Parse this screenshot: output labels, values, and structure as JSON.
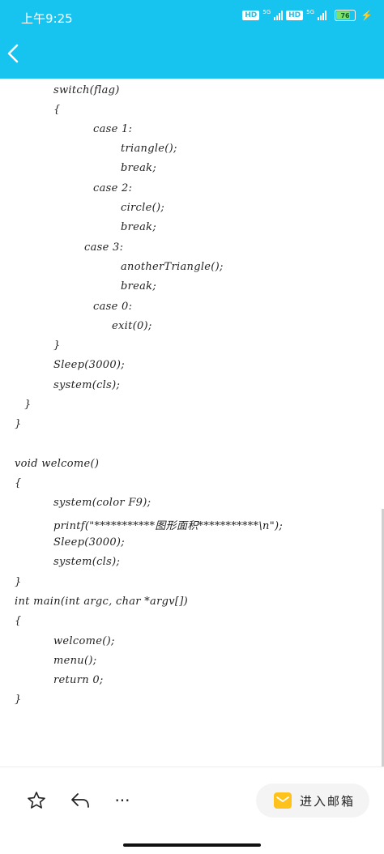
{
  "status_bar": {
    "time": "上午9:25",
    "hd1": "HD",
    "net1": "5G",
    "hd2": "HD",
    "net2": "5G",
    "battery": "76"
  },
  "header": {
    "back_icon": "chevron-left-icon"
  },
  "code_lines": [
    {
      "text": "switch(flag)"
    },
    {
      "text": "{"
    },
    {
      "text": "case 1:"
    },
    {
      "text": "triangle();"
    },
    {
      "text": "break;"
    },
    {
      "text": "case 2:"
    },
    {
      "text": "circle();"
    },
    {
      "text": "break;"
    },
    {
      "text": "case 3:"
    },
    {
      "text": "anotherTriangle();"
    },
    {
      "text": "break;"
    },
    {
      "text": "case 0:"
    },
    {
      "text": "exit(0);"
    },
    {
      "text": "}"
    },
    {
      "text": "Sleep(3000);"
    },
    {
      "text": "system(cls);"
    },
    {
      "text": "}"
    },
    {
      "text": "}"
    },
    {
      "text": "void welcome()"
    },
    {
      "text": "{"
    },
    {
      "text": "system(color F9);"
    },
    {
      "text": "printf(\"***********图形面积***********\\n\");"
    },
    {
      "text": "Sleep(3000);"
    },
    {
      "text": "system(cls);"
    },
    {
      "text": "}"
    },
    {
      "text": "int main(int argc, char *argv[])"
    },
    {
      "text": "{"
    },
    {
      "text": "welcome();"
    },
    {
      "text": "menu();"
    },
    {
      "text": "return 0;"
    },
    {
      "text": "}"
    }
  ],
  "toolbar": {
    "star_icon": "star-icon",
    "reply_icon": "reply-icon",
    "more_icon": "more-icon",
    "more_label": "···",
    "mail_label": "进入邮箱",
    "accent": "#ffc21b"
  },
  "colors": {
    "header": "#17c4f0"
  }
}
